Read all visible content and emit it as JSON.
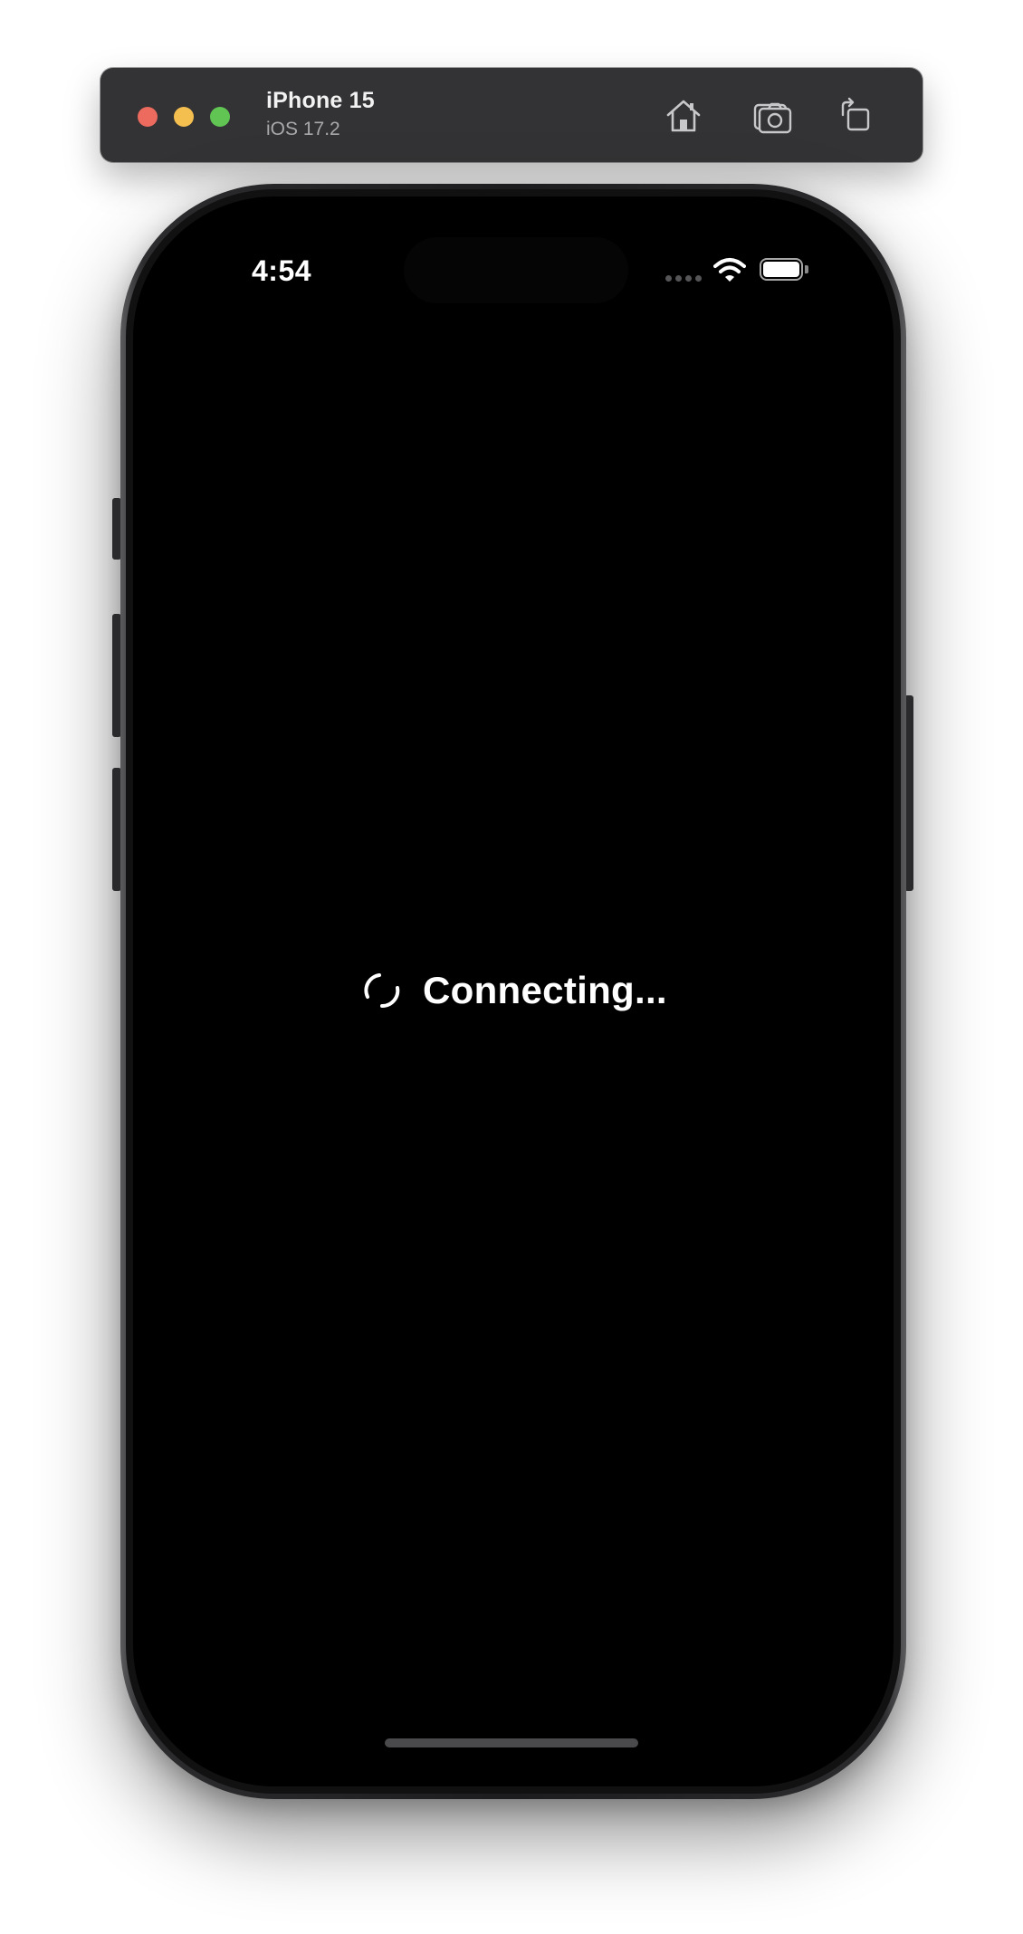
{
  "simulator": {
    "device_name": "iPhone 15",
    "os_version": "iOS 17.2",
    "toolbar": {
      "home_icon": "house-icon",
      "screenshot_icon": "camera-icon",
      "rotate_icon": "rotate-icon"
    },
    "traffic_lights": {
      "close_color": "#ed6a5e",
      "minimize_color": "#f5bf4f",
      "zoom_color": "#61c554"
    }
  },
  "status_bar": {
    "time": "4:54",
    "cellular_icon": "cellular-dots-icon",
    "wifi_icon": "wifi-icon",
    "battery_icon": "battery-icon"
  },
  "screen": {
    "background": "#000000",
    "loading_icon": "spinner-icon",
    "loading_text": "Connecting..."
  }
}
